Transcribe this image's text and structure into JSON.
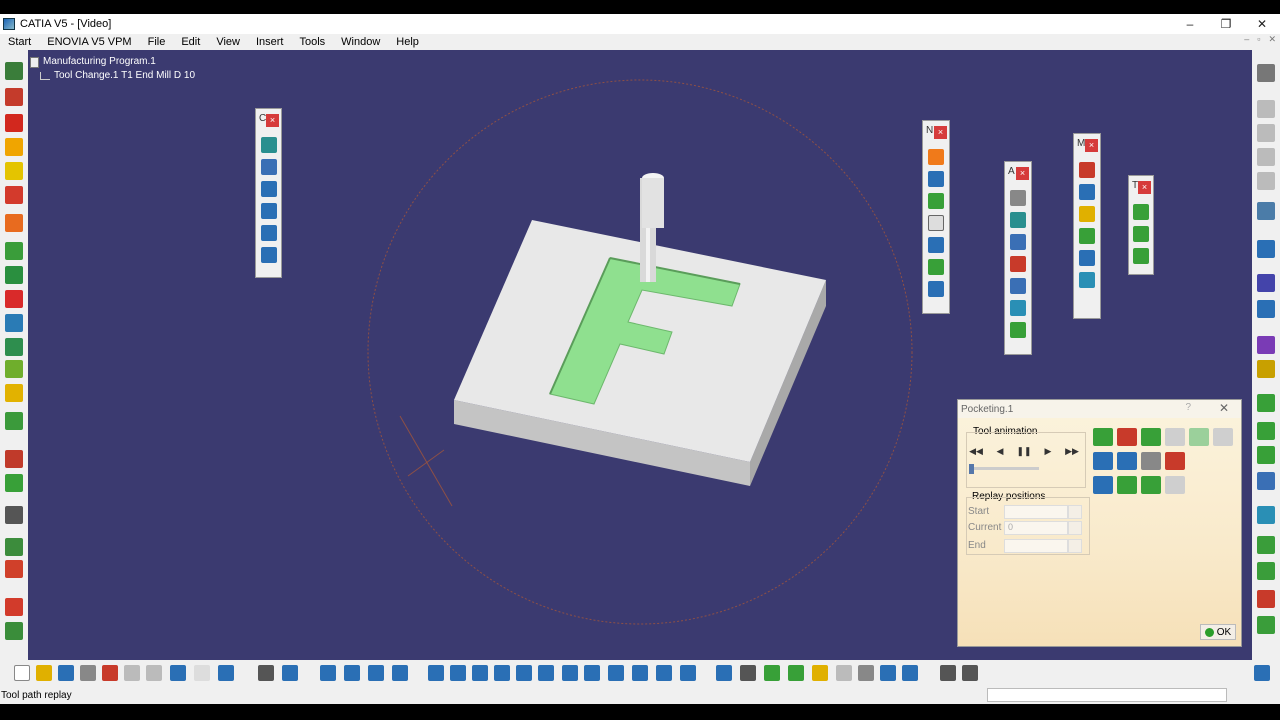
{
  "window": {
    "title": "CATIA V5 - [Video]",
    "minimize": "–",
    "maximize": "❐",
    "close": "✕"
  },
  "menu": {
    "items": [
      "Start",
      "ENOVIA V5 VPM",
      "File",
      "Edit",
      "View",
      "Insert",
      "Tools",
      "Window",
      "Help"
    ],
    "doc_controls": [
      "–",
      "▫",
      "✕"
    ]
  },
  "tree": {
    "root": "Manufacturing Program.1",
    "child": "Tool Change.1  T1 End Mill D 10"
  },
  "floating_toolbars": [
    {
      "letter": "C",
      "close": "×"
    },
    {
      "letter": "N",
      "close": "×"
    },
    {
      "letter": "A",
      "close": "×"
    },
    {
      "letter": "M",
      "close": "×"
    },
    {
      "letter": "T",
      "close": "×"
    }
  ],
  "dialog": {
    "title": "Pocketing.1",
    "help": "?",
    "close": "✕",
    "tool_animation_label": "Tool animation",
    "anim_buttons": [
      "◀◀",
      "◀",
      "❚❚",
      "▶",
      "▶▶"
    ],
    "replay_positions_label": "Replay positions",
    "start_label": "Start",
    "current_label": "Current",
    "current_value": "0",
    "end_label": "End",
    "ok_label": "OK"
  },
  "statusbar": {
    "text": "Tool path replay"
  },
  "colors": {
    "viewport_bg": "#3b3a70",
    "pocket_green": "#8fe08f",
    "part_face": "#e8e8e8"
  }
}
